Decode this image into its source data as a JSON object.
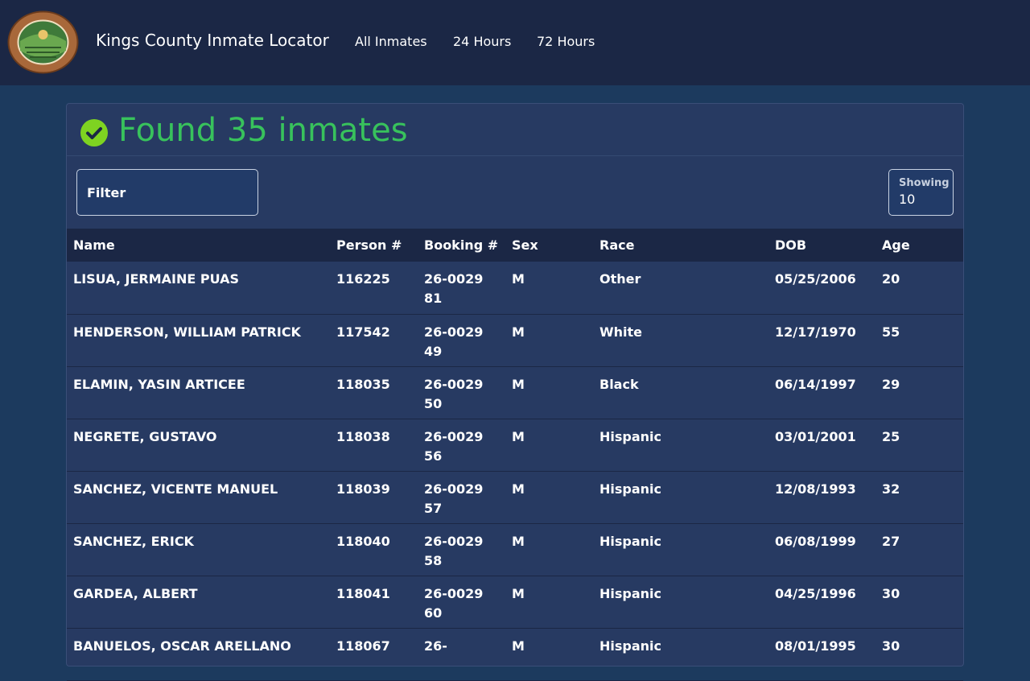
{
  "navbar": {
    "logo_text_top": "COUNTY OF KINGS",
    "logo_text_bottom": "CALIFORNIA",
    "brand": "Kings County Inmate Locator",
    "links": [
      "All Inmates",
      "24 Hours",
      "72 Hours"
    ]
  },
  "results": {
    "title": "Found 35 inmates",
    "check_icon": "check-circle-icon",
    "accent_color": "#38c25c"
  },
  "filter": {
    "placeholder": "Filter"
  },
  "showing": {
    "label": "Showing",
    "value": "10"
  },
  "table": {
    "columns": [
      "Name",
      "Person #",
      "Booking #",
      "Sex",
      "Race",
      "DOB",
      "Age"
    ],
    "rows": [
      [
        "LISUA, JERMAINE PUAS",
        "116225",
        "26-002981",
        "M",
        "Other",
        "05/25/2006",
        "20"
      ],
      [
        "HENDERSON, WILLIAM PATRICK",
        "117542",
        "26-002949",
        "M",
        "White",
        "12/17/1970",
        "55"
      ],
      [
        "ELAMIN, YASIN ARTICEE",
        "118035",
        "26-002950",
        "M",
        "Black",
        "06/14/1997",
        "29"
      ],
      [
        "NEGRETE, GUSTAVO",
        "118038",
        "26-002956",
        "M",
        "Hispanic",
        "03/01/2001",
        "25"
      ],
      [
        "SANCHEZ, VICENTE MANUEL",
        "118039",
        "26-002957",
        "M",
        "Hispanic",
        "12/08/1993",
        "32"
      ],
      [
        "SANCHEZ, ERICK",
        "118040",
        "26-002958",
        "M",
        "Hispanic",
        "06/08/1999",
        "27"
      ],
      [
        "GARDEA, ALBERT",
        "118041",
        "26-002960",
        "M",
        "Hispanic",
        "04/25/1996",
        "30"
      ],
      [
        "BANUELOS, OSCAR ARELLANO",
        "118067",
        "26-",
        "M",
        "Hispanic",
        "08/01/1995",
        "30"
      ]
    ]
  }
}
